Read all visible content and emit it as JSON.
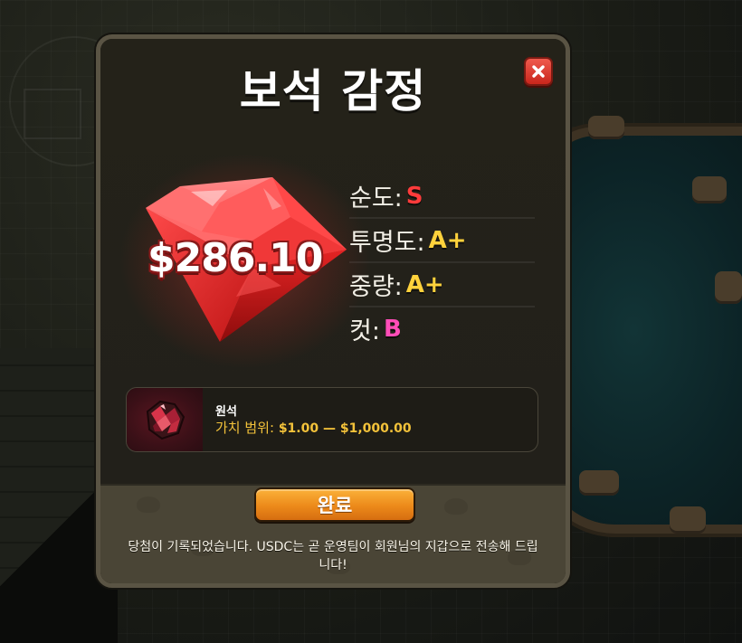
{
  "modal": {
    "title": "보석 감정",
    "gem_price": "$286.10",
    "attributes": [
      {
        "label": "순도:",
        "grade": "S",
        "color": "#ff3b3b"
      },
      {
        "label": "투명도:",
        "grade": "A+",
        "color": "#ffd23c"
      },
      {
        "label": "중량:",
        "grade": "A+",
        "color": "#ffd23c"
      },
      {
        "label": "컷:",
        "grade": "B",
        "color": "#ff4db8"
      }
    ],
    "item": {
      "name": "원석",
      "range_label": "가치 범위:",
      "range_value": "$1.00 — $1,000.00"
    },
    "done_label": "완료",
    "notice": "당첨이 기록되었습니다. USDC는 곧 운영팀이 회원님의 지갑으로 전송해 드립니다!"
  },
  "icons": {
    "close": "close-icon",
    "gem": "red-gem-icon",
    "item": "raw-gem-icon"
  },
  "colors": {
    "accent_orange": "#ec8a1a",
    "close_red": "#c9261c",
    "gold_text": "#f3c23a"
  }
}
